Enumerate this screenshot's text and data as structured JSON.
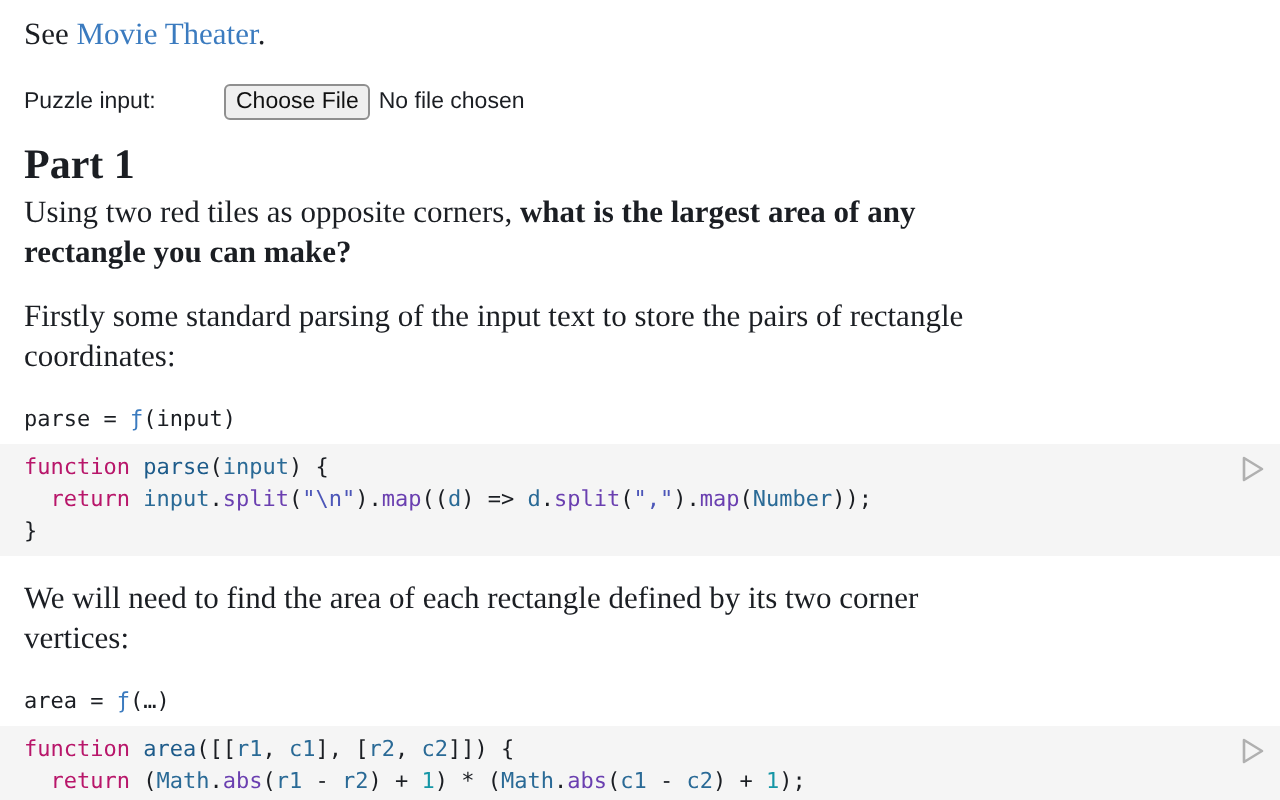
{
  "intro": {
    "prefix": "See ",
    "link": "Movie Theater",
    "suffix": "."
  },
  "file_input": {
    "label": "Puzzle input:",
    "button": "Choose File",
    "status": "No file chosen"
  },
  "heading": "Part 1",
  "blocks": [
    {
      "kind": "text",
      "text": "Using two red tiles as opposite corners, **what is the largest area of any rectangle you can make?**"
    },
    {
      "kind": "text",
      "text": "Firstly some standard parsing of the input text to store the pairs of rectangle coordinates:"
    },
    {
      "kind": "cell",
      "header": [
        {
          "text": "parse = ",
          "kind": "plain"
        },
        {
          "text": "ƒ",
          "kind": "fn"
        },
        {
          "text": "(input)",
          "kind": "plain"
        }
      ],
      "lines": [
        [
          {
            "text": "function ",
            "kind": "kw"
          },
          {
            "text": "parse",
            "kind": "def"
          },
          {
            "text": "(",
            "kind": "plain"
          },
          {
            "text": "input",
            "kind": "var"
          },
          {
            "text": ") {",
            "kind": "plain"
          }
        ],
        [
          {
            "text": "  return ",
            "kind": "kw"
          },
          {
            "text": "input",
            "kind": "var"
          },
          {
            "text": ".",
            "kind": "plain"
          },
          {
            "text": "split",
            "kind": "prop"
          },
          {
            "text": "(",
            "kind": "plain"
          },
          {
            "text": "\"\\n\"",
            "kind": "str"
          },
          {
            "text": ").",
            "kind": "plain"
          },
          {
            "text": "map",
            "kind": "prop"
          },
          {
            "text": "((",
            "kind": "plain"
          },
          {
            "text": "d",
            "kind": "var"
          },
          {
            "text": ") => ",
            "kind": "plain"
          },
          {
            "text": "d",
            "kind": "var"
          },
          {
            "text": ".",
            "kind": "plain"
          },
          {
            "text": "split",
            "kind": "prop"
          },
          {
            "text": "(",
            "kind": "plain"
          },
          {
            "text": "\",\"",
            "kind": "str"
          },
          {
            "text": ").",
            "kind": "plain"
          },
          {
            "text": "map",
            "kind": "prop"
          },
          {
            "text": "(",
            "kind": "plain"
          },
          {
            "text": "Number",
            "kind": "var"
          },
          {
            "text": "));",
            "kind": "plain"
          }
        ],
        [
          {
            "text": "}",
            "kind": "plain"
          }
        ]
      ]
    },
    {
      "kind": "text",
      "text": "We will need to find the area of each rectangle defined by its two corner vertices:"
    },
    {
      "kind": "cell",
      "header": [
        {
          "text": "area = ",
          "kind": "plain"
        },
        {
          "text": "ƒ",
          "kind": "fn"
        },
        {
          "text": "(…)",
          "kind": "plain"
        }
      ],
      "lines": [
        [
          {
            "text": "function ",
            "kind": "kw"
          },
          {
            "text": "area",
            "kind": "def"
          },
          {
            "text": "([[",
            "kind": "plain"
          },
          {
            "text": "r1",
            "kind": "var"
          },
          {
            "text": ", ",
            "kind": "plain"
          },
          {
            "text": "c1",
            "kind": "var"
          },
          {
            "text": "], [",
            "kind": "plain"
          },
          {
            "text": "r2",
            "kind": "var"
          },
          {
            "text": ", ",
            "kind": "plain"
          },
          {
            "text": "c2",
            "kind": "var"
          },
          {
            "text": "]]) {",
            "kind": "plain"
          }
        ],
        [
          {
            "text": "  return",
            "kind": "kw"
          },
          {
            "text": " (",
            "kind": "plain"
          },
          {
            "text": "Math",
            "kind": "var"
          },
          {
            "text": ".",
            "kind": "plain"
          },
          {
            "text": "abs",
            "kind": "prop"
          },
          {
            "text": "(",
            "kind": "plain"
          },
          {
            "text": "r1",
            "kind": "var"
          },
          {
            "text": " - ",
            "kind": "plain"
          },
          {
            "text": "r2",
            "kind": "var"
          },
          {
            "text": ") + ",
            "kind": "plain"
          },
          {
            "text": "1",
            "kind": "num"
          },
          {
            "text": ") * (",
            "kind": "plain"
          },
          {
            "text": "Math",
            "kind": "var"
          },
          {
            "text": ".",
            "kind": "plain"
          },
          {
            "text": "abs",
            "kind": "prop"
          },
          {
            "text": "(",
            "kind": "plain"
          },
          {
            "text": "c1",
            "kind": "var"
          },
          {
            "text": " - ",
            "kind": "plain"
          },
          {
            "text": "c2",
            "kind": "var"
          },
          {
            "text": ") + ",
            "kind": "plain"
          },
          {
            "text": "1",
            "kind": "num"
          },
          {
            "text": ");",
            "kind": "plain"
          }
        ]
      ]
    }
  ]
}
